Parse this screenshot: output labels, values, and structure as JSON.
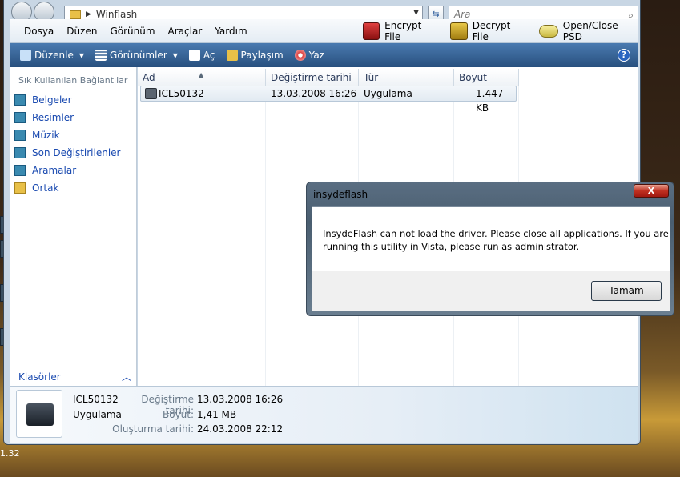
{
  "address": {
    "path": "Winflash",
    "search_placeholder": "Ara"
  },
  "menu": [
    "Dosya",
    "Düzen",
    "Görünüm",
    "Araçlar",
    "Yardım"
  ],
  "plugins": [
    {
      "label": "Encrypt File",
      "icon": "lock-icon"
    },
    {
      "label": "Decrypt File",
      "icon": "unlock-icon"
    },
    {
      "label": "Open/Close PSD",
      "icon": "drive-icon"
    }
  ],
  "toolbar": {
    "organize": "Düzenle",
    "views": "Görünümler",
    "open": "Aç",
    "share": "Paylaşım",
    "burn": "Yaz",
    "help": "?"
  },
  "favorites": {
    "title": "Sık Kullanılan Bağlantılar",
    "items": [
      "Belgeler",
      "Resimler",
      "Müzik",
      "Son Değiştirilenler",
      "Aramalar",
      "Ortak"
    ]
  },
  "folders_label": "Klasörler",
  "columns": [
    "Ad",
    "Değiştirme tarihi",
    "Tür",
    "Boyut"
  ],
  "file": {
    "name": "ICL50132",
    "modified": "13.03.2008 16:26",
    "type": "Uygulama",
    "size": "1.447 KB"
  },
  "details": {
    "name": "ICL50132",
    "type": "Uygulama",
    "modified_label": "Değiştirme tarihi:",
    "modified": "13.03.2008 16:26",
    "size_label": "Boyut:",
    "size": "1,41 MB",
    "created_label": "Oluşturma tarihi:",
    "created": "24.03.2008 22:12"
  },
  "dialog": {
    "title": "insydeflash",
    "close": "X",
    "message": "InsydeFlash can not load the driver. Please close all applications. If you are running this utility in Vista, please run as administrator.",
    "ok": "Tamam"
  },
  "desktop_text": "1.32"
}
